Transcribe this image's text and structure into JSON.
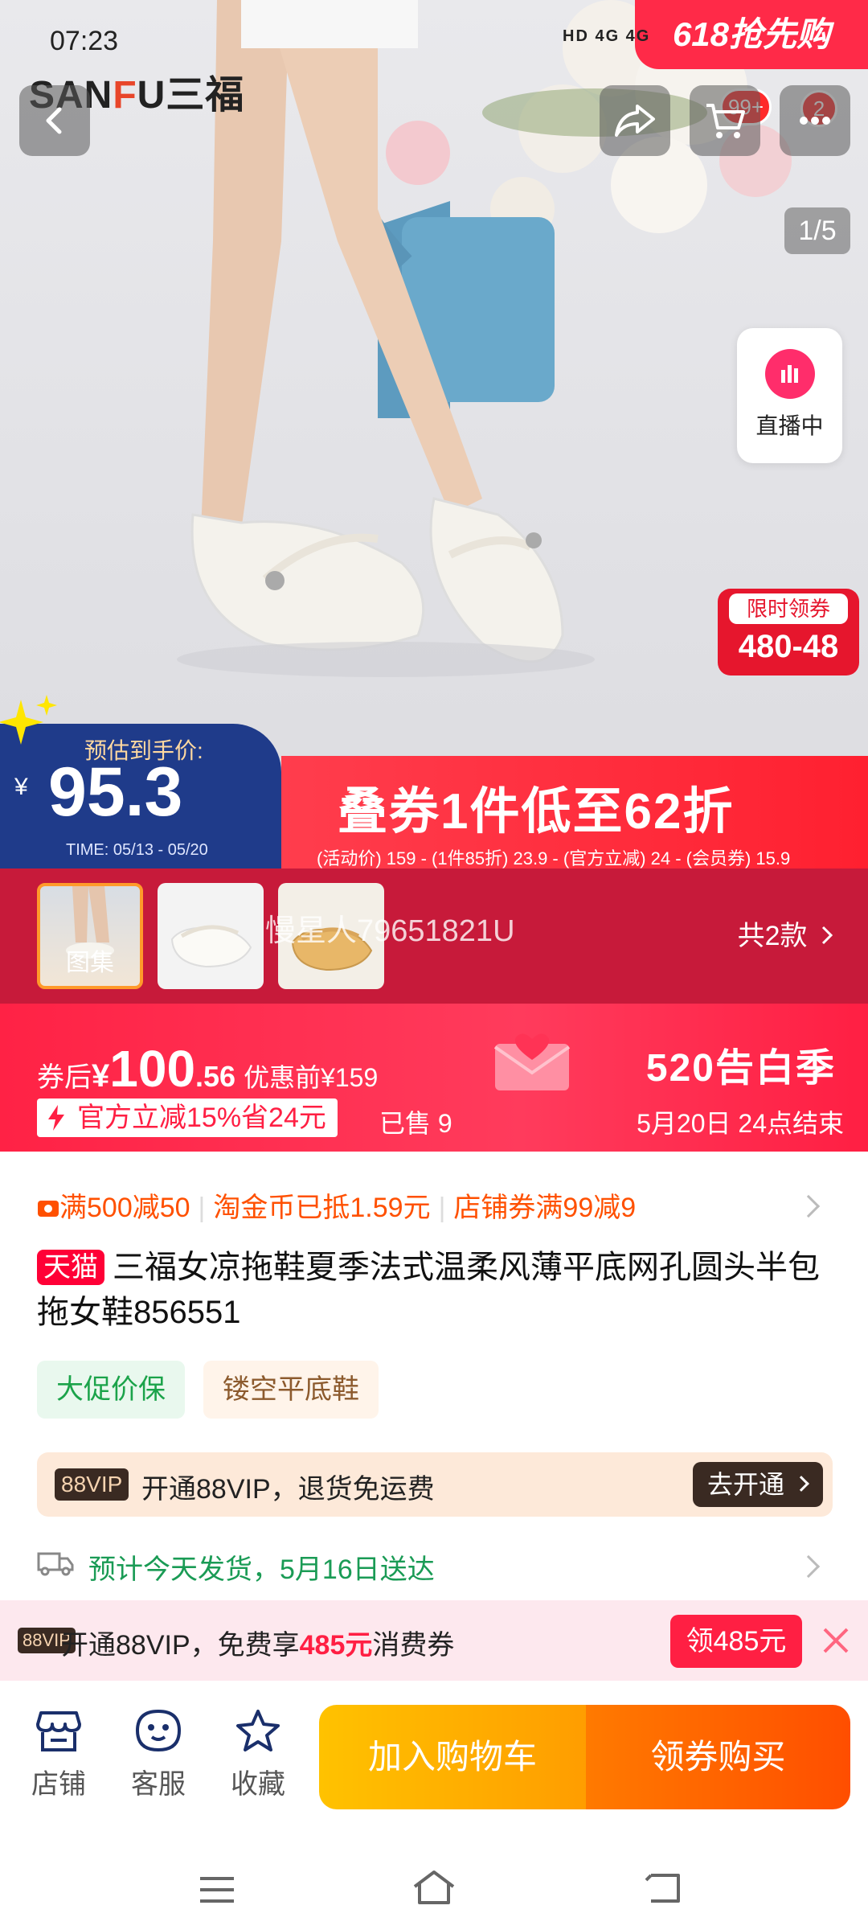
{
  "status_bar": {
    "time": "07:23",
    "network_icons": "HD 4G 4G"
  },
  "promo_badge": "618抢先购",
  "brand_logo": {
    "text_a": "SAN",
    "text_f": "F",
    "text_b": "U三福"
  },
  "header": {
    "cart_count": "99+",
    "message_count": "2"
  },
  "gallery": {
    "pager": "1/5",
    "live_label": "直播中",
    "limited_title": "限时领券",
    "limited_value": "480-48"
  },
  "estimate": {
    "title": "预估到手价:",
    "currency": "¥",
    "price": "95.3",
    "time": "TIME: 05/13 - 05/20"
  },
  "stack_banner": {
    "title": "叠券1件低至62折",
    "breakdown": "(活动价) 159 - (1件85折) 23.9 - (官方立减) 24 - (会员券) 15.9"
  },
  "thumbnails": {
    "first_label": "图集",
    "watermark": "慢星人79651821U",
    "variants": "共2款"
  },
  "price_bar": {
    "after_label": "券后",
    "currency": "¥",
    "after_int": "100",
    "after_dec": ".56",
    "before": "优惠前¥159",
    "official_off": "官方立减15%省24元",
    "sold": "已售 9",
    "season": "520告白季",
    "season_end": "5月20日 24点结束"
  },
  "coupons": {
    "c1": "满500减50",
    "c2": "淘金币已抵1.59元",
    "c3": "店铺券满99减9"
  },
  "product": {
    "tmall": "天猫",
    "title": "三福女凉拖鞋夏季法式温柔风薄平底网孔圆头半包拖女鞋856551"
  },
  "tags": [
    "大促价保",
    "镂空平底鞋"
  ],
  "vip_row": {
    "badge": "88VIP",
    "text": "开通88VIP，退货免运费",
    "button": "去开通"
  },
  "shipping": "预计今天发货，5月16日送达",
  "vip_strip": {
    "badge": "88VIP",
    "text_a": "开通88VIP，免费享",
    "highlight": "485元",
    "text_b": "消费券",
    "button": "领485元"
  },
  "actions": {
    "shop": "店铺",
    "service": "客服",
    "favorite": "收藏",
    "add_cart": "加入购物车",
    "buy": "领券购买"
  },
  "colors": {
    "brand_red": "#ff1f43",
    "tmall_red": "#ff0036",
    "accent_orange": "#ff5000",
    "ship_green": "#1a9b55"
  }
}
